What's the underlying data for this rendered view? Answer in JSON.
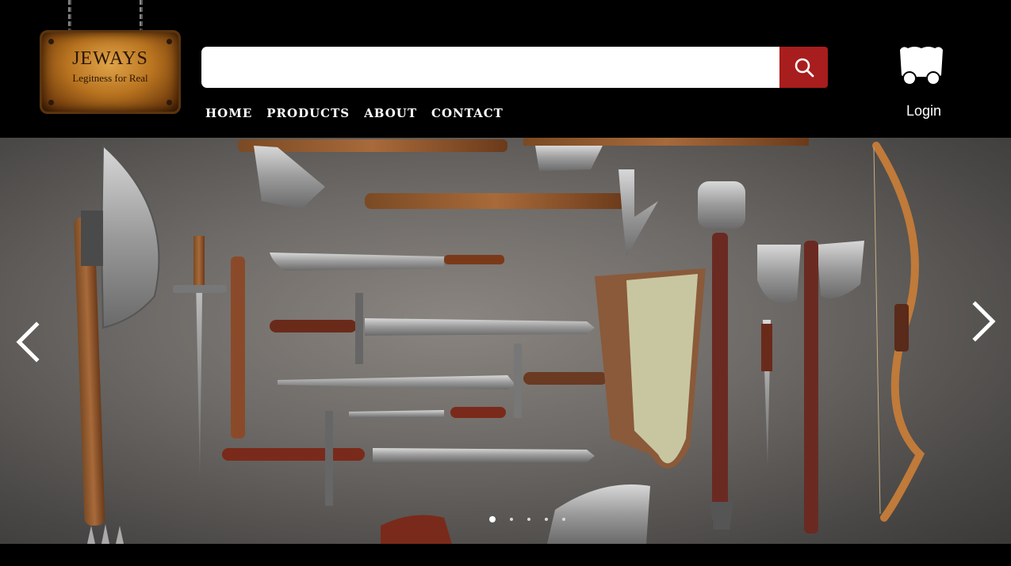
{
  "brand": {
    "name": "JEWAYS",
    "tagline": "Legitness for Real"
  },
  "search": {
    "placeholder": "",
    "value": "",
    "button_icon": "search-icon"
  },
  "nav": {
    "items": [
      {
        "label": "HOME"
      },
      {
        "label": "PRODUCTS"
      },
      {
        "label": "ABOUT"
      },
      {
        "label": "CONTACT"
      }
    ]
  },
  "account": {
    "cart_icon": "wagon-cart-icon",
    "login_label": "Login"
  },
  "carousel": {
    "slide_count": 5,
    "active_index": 0,
    "prev_icon": "chevron-left-icon",
    "next_icon": "chevron-right-icon"
  },
  "colors": {
    "header_bg": "#000000",
    "accent": "#a81d1d",
    "text": "#ffffff"
  }
}
